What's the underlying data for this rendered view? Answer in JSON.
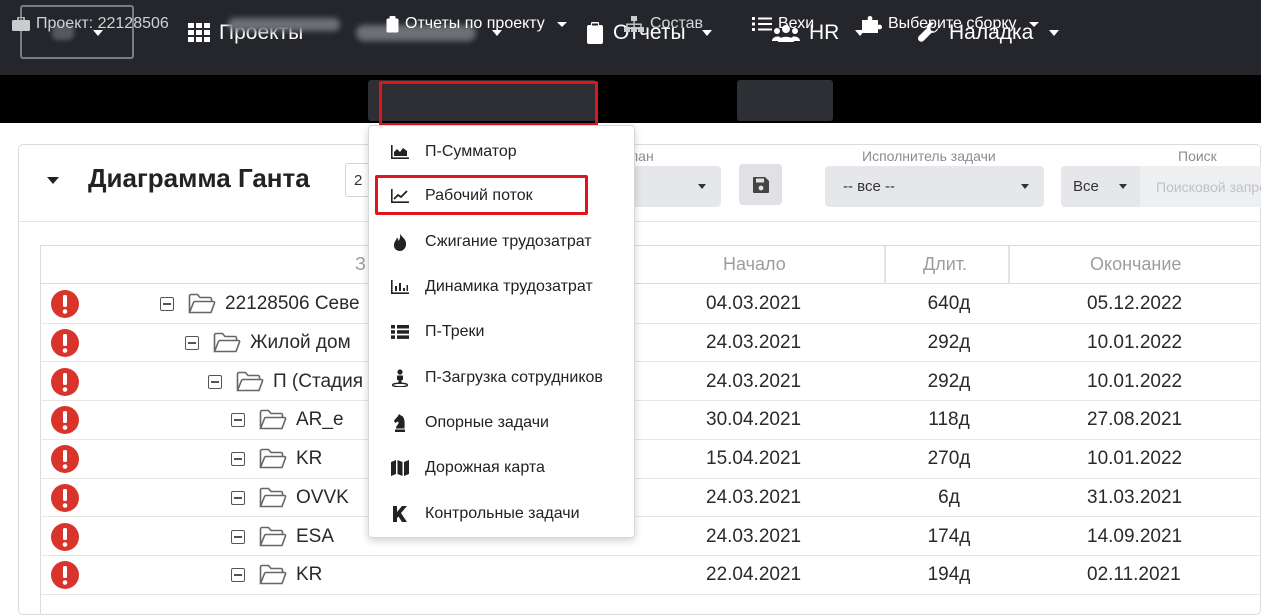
{
  "topnav": {
    "projects_label": "Проекты",
    "reports_label": "Отчеты",
    "hr_label": "HR",
    "setup_label": "Наладка"
  },
  "subnav": {
    "project_label": "Проект: 22128506",
    "project_reports_label": "Отчеты по проекту",
    "composition_label": "Состав",
    "milestones_label": "Вехи",
    "build_label": "Выберите сборку"
  },
  "panel": {
    "title": "Диаграмма Ганта",
    "small_select_value": "2",
    "plan_label": "лан",
    "assignee_label": "Исполнитель задачи",
    "assignee_value": "-- все --",
    "search_label": "Поиск",
    "search_scope": "Все",
    "search_placeholder": "Поисковой запрос"
  },
  "dropdown": {
    "items": [
      {
        "label": "П-Сумматор",
        "icon": "area-chart-icon"
      },
      {
        "label": "Рабочий поток",
        "icon": "line-chart-icon"
      },
      {
        "label": "Сжигание трудозатрат",
        "icon": "fire-icon"
      },
      {
        "label": "Динамика трудозатрат",
        "icon": "bar-chart-icon"
      },
      {
        "label": "П-Треки",
        "icon": "list-icon"
      },
      {
        "label": "П-Загрузка сотрудников",
        "icon": "user-load-icon"
      },
      {
        "label": "Опорные задачи",
        "icon": "chess-knight-icon"
      },
      {
        "label": "Дорожная карта",
        "icon": "map-icon"
      },
      {
        "label": "Контрольные задачи",
        "icon": "k-icon"
      }
    ]
  },
  "table": {
    "headers": {
      "name": "З",
      "start": "Начало",
      "duration": "Длит.",
      "end": "Окончание"
    },
    "rows": [
      {
        "name": "22128506 Севе",
        "start": "04.03.2021",
        "duration": "640д",
        "end": "05.12.2022"
      },
      {
        "name": "Жилой дом",
        "start": "24.03.2021",
        "duration": "292д",
        "end": "10.01.2022"
      },
      {
        "name": "П (Стадия",
        "start": "24.03.2021",
        "duration": "292д",
        "end": "10.01.2022"
      },
      {
        "name": "AR_e",
        "start": "30.04.2021",
        "duration": "118д",
        "end": "27.08.2021"
      },
      {
        "name": "KR",
        "start": "15.04.2021",
        "duration": "270д",
        "end": "10.01.2022"
      },
      {
        "name": "OVVK",
        "start": "24.03.2021",
        "duration": "6д",
        "end": "31.03.2021"
      },
      {
        "name": "ESA",
        "start": "24.03.2021",
        "duration": "174д",
        "end": "14.09.2021"
      },
      {
        "name": "KR",
        "start": "22.04.2021",
        "duration": "194д",
        "end": "02.11.2021"
      }
    ]
  },
  "colors": {
    "topbar": "#24262b",
    "subbar": "#000000",
    "highlight": "#e0141c",
    "alert": "#d9342b"
  }
}
